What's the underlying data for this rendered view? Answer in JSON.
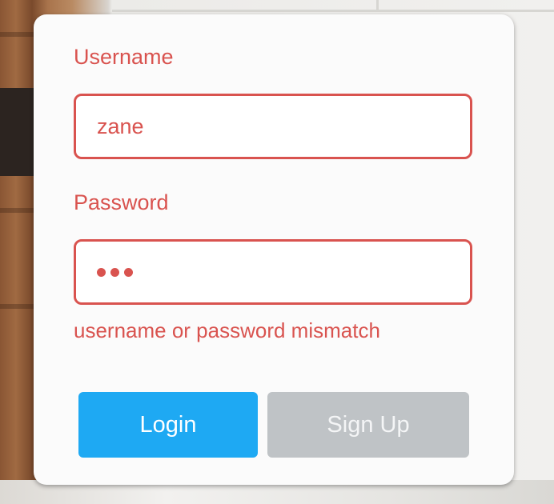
{
  "form": {
    "username_label": "Username",
    "username_value": "zane",
    "password_label": "Password",
    "password_mask": "•••",
    "error_message": "username or password mismatch"
  },
  "buttons": {
    "login_label": "Login",
    "signup_label": "Sign Up"
  },
  "colors": {
    "error": "#d9534f",
    "login_button": "#1ea9f3",
    "signup_button": "#bfc3c6"
  }
}
